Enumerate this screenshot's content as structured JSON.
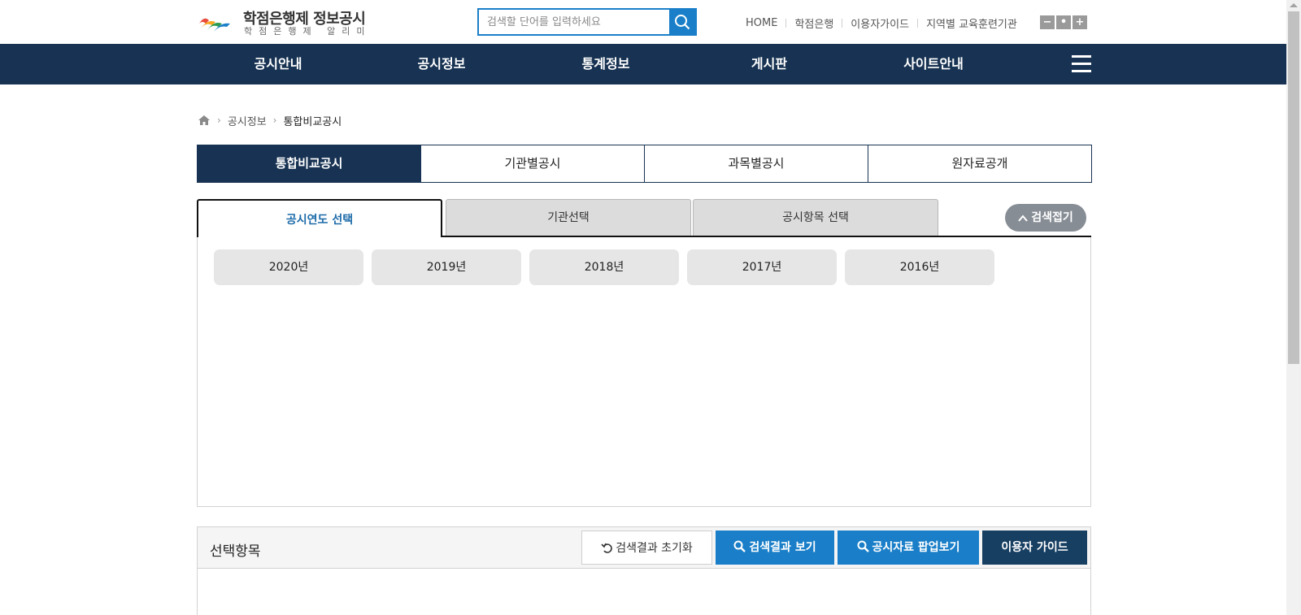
{
  "header": {
    "logo_title": "학점은행제 정보공시",
    "logo_subtitle": "학점은행제 알리미",
    "search_placeholder": "검색할 단어를 입력하세요",
    "util_links": [
      "HOME",
      "학점은행",
      "이용자가이드",
      "지역별 교육훈련기관"
    ],
    "font_controls": [
      "−",
      "•",
      "+"
    ]
  },
  "gnb": {
    "items": [
      "공시안내",
      "공시정보",
      "통계정보",
      "게시판",
      "사이트안내"
    ]
  },
  "breadcrumb": {
    "items": [
      "공시정보",
      "통합비교공시"
    ]
  },
  "main_tabs": [
    {
      "label": "통합비교공시",
      "active": true
    },
    {
      "label": "기관별공시",
      "active": false
    },
    {
      "label": "과목별공시",
      "active": false
    },
    {
      "label": "원자료공개",
      "active": false
    }
  ],
  "sub_tabs": [
    {
      "label": "공시연도 선택",
      "active": true
    },
    {
      "label": "기관선택",
      "active": false
    },
    {
      "label": "공시항목 선택",
      "active": false
    }
  ],
  "collapse_label": "검색접기",
  "years": [
    "2020년",
    "2019년",
    "2018년",
    "2017년",
    "2016년"
  ],
  "selected": {
    "title": "선택항목",
    "buttons": {
      "reset": "검색결과 초기화",
      "result": "검색결과 보기",
      "popup": "공시자료 팝업보기",
      "guide": "이용자 가이드"
    }
  },
  "colors": {
    "navy": "#173252",
    "blue": "#1a7fc8",
    "guide_button": "#173f62"
  }
}
